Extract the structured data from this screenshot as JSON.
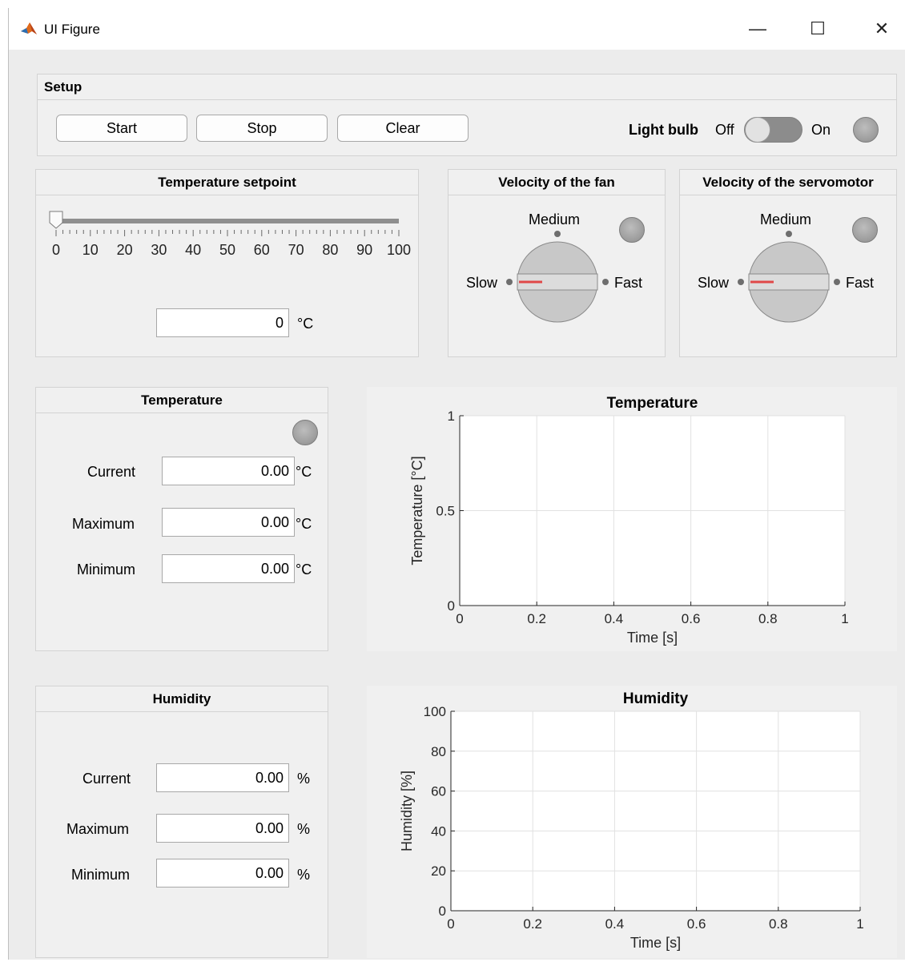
{
  "window": {
    "title": "UI Figure",
    "minimize": "—",
    "maximize": "☐",
    "close": "✕"
  },
  "setup": {
    "title": "Setup",
    "start_label": "Start",
    "stop_label": "Stop",
    "clear_label": "Clear",
    "lightbulb_label": "Light bulb",
    "switch_off": "Off",
    "switch_on": "On",
    "switch_value": "Off"
  },
  "setpoint": {
    "title": "Temperature setpoint",
    "slider_value": 0,
    "ticks": [
      "0",
      "10",
      "20",
      "30",
      "40",
      "50",
      "60",
      "70",
      "80",
      "90",
      "100"
    ],
    "value": "0",
    "unit": "°C"
  },
  "fan": {
    "title": "Velocity of the fan",
    "medium": "Medium",
    "slow": "Slow",
    "fast": "Fast",
    "value": "Slow"
  },
  "servo": {
    "title": "Velocity of the servomotor",
    "medium": "Medium",
    "slow": "Slow",
    "fast": "Fast",
    "value": "Slow"
  },
  "temperature": {
    "title": "Temperature",
    "current_label": "Current",
    "current_value": "0.00",
    "maximum_label": "Maximum",
    "maximum_value": "0.00",
    "minimum_label": "Minimum",
    "minimum_value": "0.00",
    "unit": "°C"
  },
  "humidity": {
    "title": "Humidity",
    "current_label": "Current",
    "current_value": "0.00",
    "maximum_label": "Maximum",
    "maximum_value": "0.00",
    "minimum_label": "Minimum",
    "minimum_value": "0.00",
    "unit": "%"
  },
  "chart_data": [
    {
      "type": "line",
      "title": "Temperature",
      "xlabel": "Time [s]",
      "ylabel": "Temperature [°C]",
      "xlim": [
        0,
        1
      ],
      "ylim": [
        0,
        1
      ],
      "xticks": [
        "0",
        "0.2",
        "0.4",
        "0.6",
        "0.8",
        "1"
      ],
      "yticks": [
        "0",
        "0.5",
        "1"
      ],
      "grid": true,
      "series": []
    },
    {
      "type": "line",
      "title": "Humidity",
      "xlabel": "Time [s]",
      "ylabel": "Humidity [%]",
      "xlim": [
        0,
        1
      ],
      "ylim": [
        0,
        100
      ],
      "xticks": [
        "0",
        "0.2",
        "0.4",
        "0.6",
        "0.8",
        "1"
      ],
      "yticks": [
        "0",
        "20",
        "40",
        "60",
        "80",
        "100"
      ],
      "grid": true,
      "series": []
    }
  ],
  "colors": {
    "knob_indicator": "#e04848",
    "lamp_off": "#a0a0a0",
    "background": "#ececec"
  }
}
